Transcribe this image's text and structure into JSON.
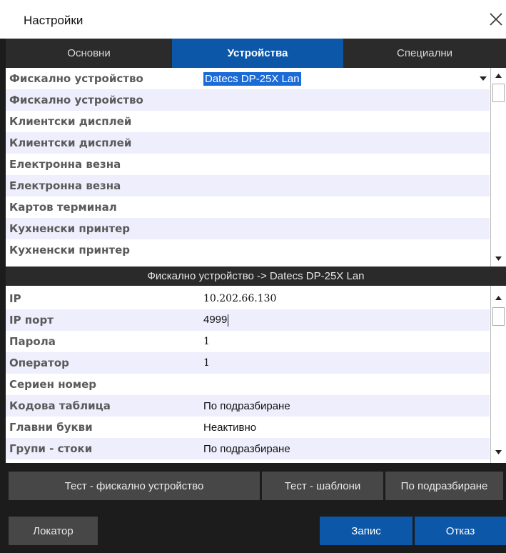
{
  "window": {
    "title": "Настройки"
  },
  "tabs": [
    {
      "label": "Основни",
      "active": false
    },
    {
      "label": "Устройства",
      "active": true
    },
    {
      "label": "Специални",
      "active": false
    }
  ],
  "devices": {
    "rows": [
      {
        "label": "Фискално устройство",
        "value": "Datecs DP-25X Lan"
      },
      {
        "label": "Фискално устройство",
        "value": ""
      },
      {
        "label": "Клиентски дисплей",
        "value": ""
      },
      {
        "label": "Клиентски дисплей",
        "value": ""
      },
      {
        "label": "Електронна везна",
        "value": ""
      },
      {
        "label": "Електронна везна",
        "value": ""
      },
      {
        "label": "Картов терминал",
        "value": ""
      },
      {
        "label": "Кухненски принтер",
        "value": ""
      },
      {
        "label": "Кухненски принтер",
        "value": ""
      }
    ]
  },
  "details": {
    "header": "Фискално устройство -> Datecs DP-25X Lan",
    "rows": [
      {
        "label": "IP",
        "value": "10.202.66.130"
      },
      {
        "label": "IP порт",
        "value": "4999"
      },
      {
        "label": "Парола",
        "value": "1"
      },
      {
        "label": "Оператор",
        "value": "1"
      },
      {
        "label": "Сериен номер",
        "value": ""
      },
      {
        "label": "Кодова таблица",
        "value": "По подразбиране"
      },
      {
        "label": "Главни букви",
        "value": "Неактивно"
      },
      {
        "label": "Групи - стоки",
        "value": "По подразбиране"
      }
    ]
  },
  "buttons": {
    "test_fiscal": "Тест - фискално устройство",
    "test_templates": "Тест - шаблони",
    "defaults": "По подразбиране",
    "locator": "Локатор",
    "save": "Запис",
    "cancel": "Отказ"
  },
  "colors": {
    "accent": "#0d57a8",
    "selection": "#1a6bd6",
    "row_alt": "#eeeefd",
    "background": "#1c1c1c"
  }
}
